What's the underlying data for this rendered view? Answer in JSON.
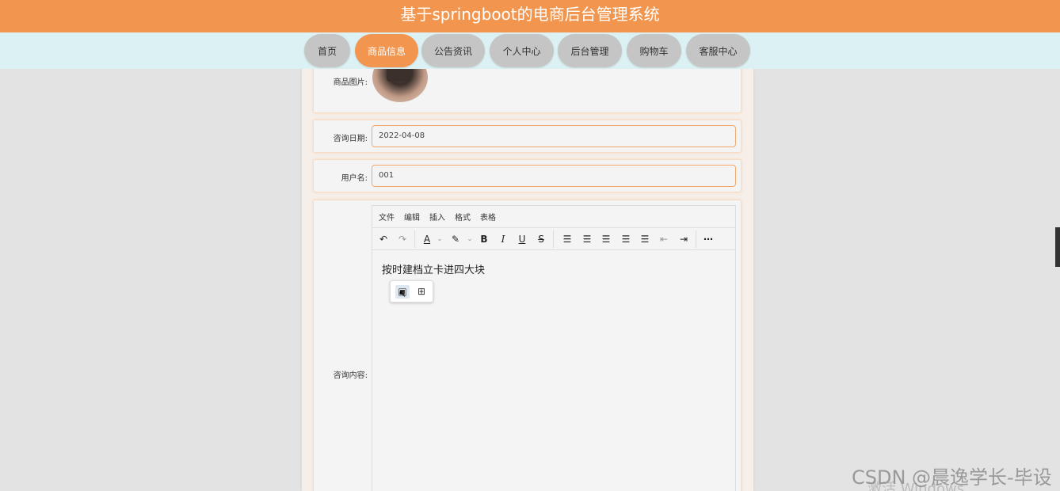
{
  "header": {
    "title": "基于springboot的电商后台管理系统"
  },
  "nav": {
    "items": [
      {
        "label": "首页",
        "active": false
      },
      {
        "label": "商品信息",
        "active": true
      },
      {
        "label": "公告资讯",
        "active": false
      },
      {
        "label": "个人中心",
        "active": false
      },
      {
        "label": "后台管理",
        "active": false
      },
      {
        "label": "购物车",
        "active": false
      },
      {
        "label": "客服中心",
        "active": false
      }
    ]
  },
  "form": {
    "image_label": "商品图片:",
    "date_label": "咨询日期:",
    "date_value": "2022-04-08",
    "username_label": "用户名:",
    "username_value": "001",
    "content_label": "咨询内容:"
  },
  "editor": {
    "menu": [
      "文件",
      "编辑",
      "插入",
      "格式",
      "表格"
    ],
    "text": "按时建档立卡进四大块",
    "toolbar_icons": [
      "undo-icon",
      "redo-icon",
      "text-color-icon",
      "highlight-icon",
      "bold-icon",
      "italic-icon",
      "underline-icon",
      "strikethrough-icon",
      "line-height-icon",
      "align-left-icon",
      "align-center-icon",
      "align-right-icon",
      "align-justify-icon",
      "outdent-icon",
      "indent-icon",
      "more-icon"
    ]
  },
  "watermark": {
    "csdn": "CSDN @晨逸学长-毕设",
    "windows": "激活 Windows"
  },
  "colors": {
    "accent": "#f2954f",
    "nav_bg": "#dcf1f4",
    "page_bg": "#e3e3e3"
  }
}
